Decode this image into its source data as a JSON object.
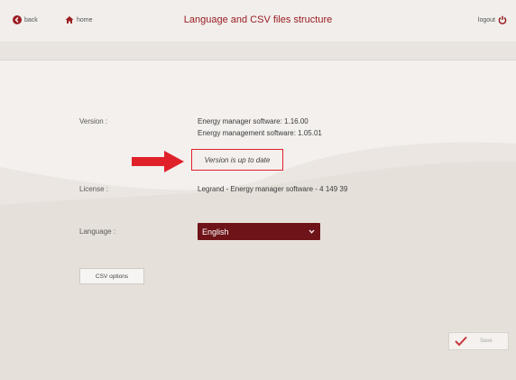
{
  "header": {
    "back_label": "back",
    "home_label": "home",
    "title": "Language and CSV files structure",
    "logout_label": "logout"
  },
  "version": {
    "label": "Version :",
    "manager_software": "Energy manager software: 1.16.00",
    "management_software": "Energy management software: 1.05.01",
    "status": "Version is up to date"
  },
  "license": {
    "label": "License :",
    "value": "Legrand - Energy manager software - 4 149 39"
  },
  "language": {
    "label": "Language :",
    "selected": "English"
  },
  "buttons": {
    "csv_options": "CSV options",
    "save": "Save"
  },
  "colors": {
    "accent": "#9b1c22",
    "select_bg": "#6e1418",
    "highlight_box": "#e0212a",
    "arrow": "#e0212a"
  },
  "icons": {
    "back": "back-circle-icon",
    "home": "home-icon",
    "logout": "power-icon",
    "arrow": "right-arrow-icon",
    "select": "chevron-down-icon",
    "save": "checkmark-icon"
  }
}
